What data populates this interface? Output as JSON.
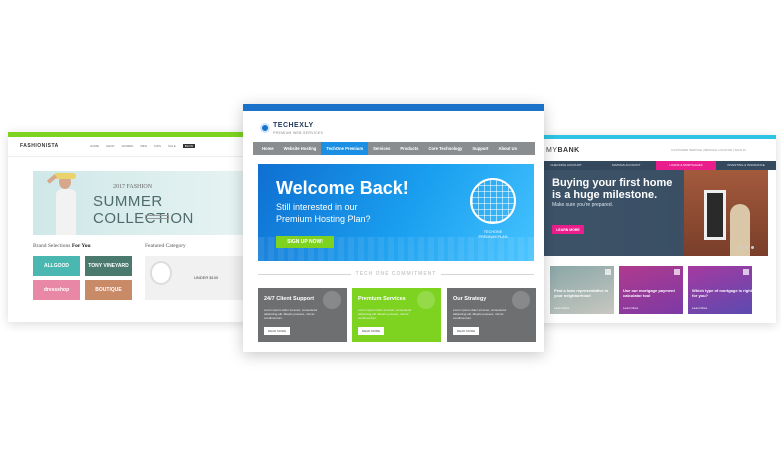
{
  "fashion": {
    "logo": "FASHIONISTA",
    "nav": [
      "HOME",
      "SHOP",
      "WOMEN",
      "MEN",
      "KIDS",
      "SALE",
      "BLOG"
    ],
    "hero": {
      "year": "2017 FASHION",
      "title": "SUMMER COLLECTION",
      "cta": "SHOP NOW"
    },
    "brands_title_prefix": "Brand Selections ",
    "brands_title_bold": "For You",
    "brands": [
      "ALLGOOD",
      "TONY VINEYARD",
      "dressshop",
      "BOUTIQUE"
    ],
    "featured_title": "Featured Category",
    "featured_tag": "UNDER $100"
  },
  "tech": {
    "logo": "TECHEXLY",
    "tagline": "PREMIUM WEB SERVICES",
    "nav": [
      "Home",
      "Website Hosting",
      "TechOne Premium",
      "Services",
      "Products",
      "Core Technology",
      "Support",
      "About Us"
    ],
    "nav_active_index": 2,
    "hero": {
      "headline": "Welcome Back!",
      "subline1": "Still interested in our",
      "subline2": "Premium Hosting Plan?",
      "cta": "SIGN UP NOW!",
      "plan_label1": "TECHONE",
      "plan_label2": "PREMIUM PLAN"
    },
    "commitment": "TECH ONE COMMITMENT",
    "boxes": [
      {
        "title": "24/7 Client Support",
        "text": "Lorem ipsum dolor sit amet, consectetur adipiscing elit. Mauris posuere, nisl ac condimentum.",
        "button": "READ MORE"
      },
      {
        "title": "Premium Services",
        "text": "Lorem ipsum dolor sit amet, consectetur adipiscing elit. Mauris posuere, nisl ac condimentum.",
        "button": "READ MORE"
      },
      {
        "title": "Our Strategy",
        "text": "Lorem ipsum dolor sit amet, consectetur adipiscing elit. Mauris posuere, nisl ac condimentum.",
        "button": "READ MORE"
      }
    ],
    "colors": {
      "primary": "#1a73c9",
      "accent": "#7ed321",
      "gray": "#6d6f71"
    }
  },
  "bank": {
    "logo_prefix": "MY",
    "logo_bold": "BANK",
    "top_links": "CUSTOMER SERVICE | BRANCH LOCATOR | SIGN IN",
    "nav": [
      "CHECKING ACCOUNT",
      "SAVINGS ACCOUNT",
      "LOANS & MORTGAGES",
      "INVESTING & INSURANCE"
    ],
    "nav_active_index": 2,
    "hero": {
      "title1": "Buying your first home",
      "title2": "is a huge milestone.",
      "subtitle": "Make sure you're prepared.",
      "cta": "LEARN MORE"
    },
    "cards": [
      {
        "title": "Find a loan representative in your neighborhood",
        "link": "Learn More"
      },
      {
        "title": "Use our mortgage payment calculator tool",
        "link": "Learn More"
      },
      {
        "title": "Which type of mortgage is right for you?",
        "link": "Learn More"
      }
    ]
  }
}
